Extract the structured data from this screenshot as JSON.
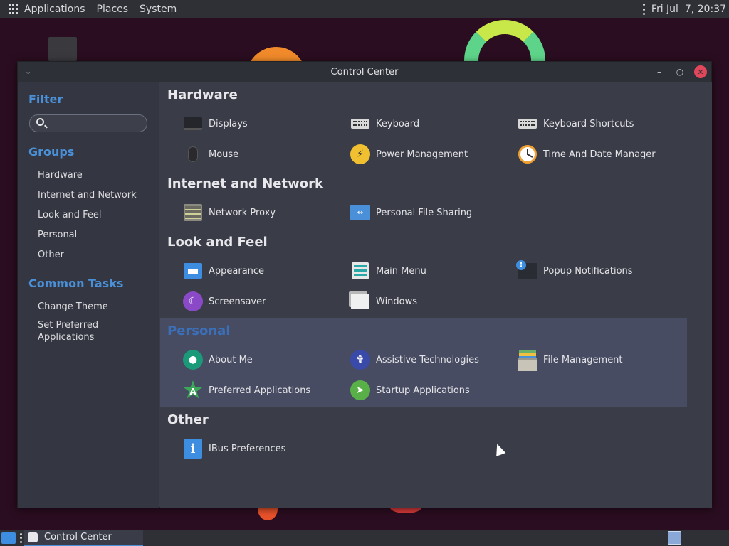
{
  "top_panel": {
    "menus": [
      "Applications",
      "Places",
      "System"
    ],
    "clock": "Fri Jul  7, 20:37"
  },
  "window": {
    "title": "Control Center"
  },
  "sidebar": {
    "filter_heading": "Filter",
    "search_value": "",
    "groups_heading": "Groups",
    "groups": [
      "Hardware",
      "Internet and Network",
      "Look and Feel",
      "Personal",
      "Other"
    ],
    "tasks_heading": "Common Tasks",
    "tasks": [
      "Change Theme",
      "Set Preferred Applications"
    ]
  },
  "sections": {
    "hardware": {
      "title": "Hardware",
      "apps": [
        "Displays",
        "Keyboard",
        "Keyboard Shortcuts",
        "Mouse",
        "Power Management",
        "Time And Date Manager"
      ]
    },
    "internet": {
      "title": "Internet and Network",
      "apps": [
        "Network Proxy",
        "Personal File Sharing"
      ]
    },
    "look": {
      "title": "Look and Feel",
      "apps": [
        "Appearance",
        "Main Menu",
        "Popup Notifications",
        "Screensaver",
        "Windows"
      ]
    },
    "personal": {
      "title": "Personal",
      "apps": [
        "About Me",
        "Assistive Technologies",
        "File Management",
        "Preferred Applications",
        "Startup Applications"
      ]
    },
    "other": {
      "title": "Other",
      "apps": [
        "IBus Preferences"
      ]
    }
  },
  "taskbar": {
    "task_label": "Control Center"
  },
  "colors": {
    "accent": "#4a90d9",
    "highlight": "#474c62",
    "close": "#e0475a"
  }
}
